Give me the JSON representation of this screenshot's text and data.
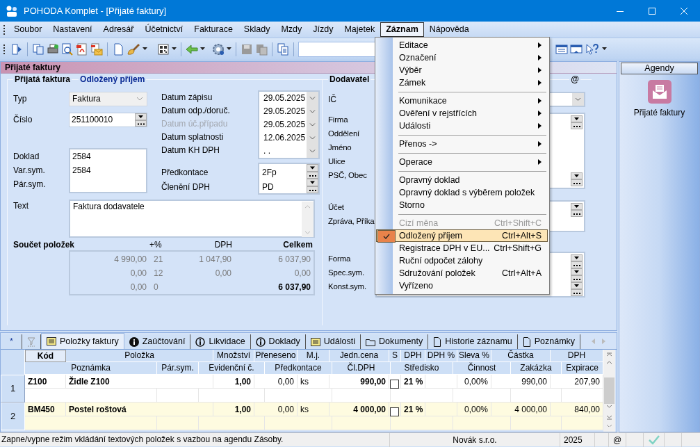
{
  "window": {
    "title": "POHODA Komplet - [Přijaté faktury]"
  },
  "menu_bar": [
    {
      "label": "Soubor",
      "selected": false
    },
    {
      "label": "Nastavení",
      "selected": false
    },
    {
      "label": "Adresář",
      "selected": false
    },
    {
      "label": "Účetnictví",
      "selected": false
    },
    {
      "label": "Fakturace",
      "selected": false
    },
    {
      "label": "Sklady",
      "selected": false
    },
    {
      "label": "Mzdy",
      "selected": false
    },
    {
      "label": "Jízdy",
      "selected": false
    },
    {
      "label": "Majetek",
      "selected": false
    },
    {
      "label": "Záznam",
      "selected": true
    },
    {
      "label": "Nápověda",
      "selected": false
    }
  ],
  "panel_title": "Přijaté faktury",
  "invoice": {
    "heading": "Přijatá faktura",
    "mode": "Odložený příjem",
    "type": {
      "label": "Typ",
      "value": "Faktura"
    },
    "number": {
      "label": "Číslo",
      "value": "251100010"
    },
    "references": [
      {
        "label": "Doklad",
        "value": "2584"
      },
      {
        "label": "Var.sym.",
        "value": "2584"
      },
      {
        "label": "Pár.sym."
      }
    ],
    "dates": [
      {
        "label": "Datum zápisu",
        "value": "29.05.2025",
        "disabled": false
      },
      {
        "label": "Datum odp./doruč.",
        "value": "29.05.2025",
        "disabled": false
      },
      {
        "label": "Datum úč.případu",
        "value": "29.05.2025",
        "disabled": true
      },
      {
        "label": "Datum splatnosti",
        "value": "12.06.2025",
        "disabled": false
      },
      {
        "label": "Datum KH DPH",
        "value": ". .",
        "disabled": false
      }
    ],
    "posting": [
      {
        "label": "Předkontace",
        "value": "2Fp"
      },
      {
        "label": "Členění DPH",
        "value": "PD"
      }
    ],
    "text": {
      "label": "Text",
      "value": "Faktura dodavatele"
    },
    "summary": {
      "title": "Součet položek",
      "columns": [
        "+%",
        "DPH",
        "Celkem"
      ],
      "rows": [
        {
          "kind": "rate",
          "base": "4 990,00",
          "rate": "21",
          "vat": "1 047,90",
          "total": "6 037,90"
        },
        {
          "kind": "rate",
          "base": "0,00",
          "rate": "12",
          "vat": "0,00",
          "total": "0,00"
        },
        {
          "kind": "total",
          "base": "0,00",
          "rate": "0",
          "total": "6 037,90"
        }
      ]
    }
  },
  "supplier": {
    "heading": "Dodavatel",
    "contact_heading": "@",
    "id_label": "IČ",
    "address_labels": [
      "Firma",
      "Oddělení",
      "Jméno",
      "Ulice",
      "PSČ, Obec"
    ],
    "bank_labels": [
      "Účet",
      "Zpráva, Příka"
    ],
    "payment_labels": [
      "Forma",
      "Spec.sym.",
      "Konst.sym."
    ]
  },
  "context_menu": {
    "items": [
      {
        "kind": "item",
        "label": "Editace",
        "submenu": true,
        "disabled": false,
        "checked": false,
        "selected": false
      },
      {
        "kind": "item",
        "label": "Označení",
        "submenu": true,
        "disabled": false,
        "checked": false,
        "selected": false
      },
      {
        "kind": "item",
        "label": "Výběr",
        "submenu": true,
        "disabled": false,
        "checked": false,
        "selected": false
      },
      {
        "kind": "item",
        "label": "Zámek",
        "submenu": true,
        "disabled": false,
        "checked": false,
        "selected": false
      },
      {
        "kind": "separator"
      },
      {
        "kind": "item",
        "label": "Komunikace",
        "submenu": true,
        "disabled": false,
        "checked": false,
        "selected": false
      },
      {
        "kind": "item",
        "label": "Ověření v rejstřících",
        "submenu": true,
        "disabled": false,
        "checked": false,
        "selected": false
      },
      {
        "kind": "item",
        "label": "Události",
        "submenu": true,
        "disabled": false,
        "checked": false,
        "selected": false
      },
      {
        "kind": "separator"
      },
      {
        "kind": "item",
        "label": "Přenos ->",
        "submenu": true,
        "disabled": false,
        "checked": false,
        "selected": false
      },
      {
        "kind": "separator"
      },
      {
        "kind": "item",
        "label": "Operace",
        "submenu": true,
        "disabled": false,
        "checked": false,
        "selected": false
      },
      {
        "kind": "separator"
      },
      {
        "kind": "item",
        "label": "Opravný doklad",
        "submenu": false,
        "disabled": false,
        "checked": false,
        "selected": false
      },
      {
        "kind": "item",
        "label": "Opravný doklad s výběrem položek",
        "submenu": false,
        "disabled": false,
        "checked": false,
        "selected": false
      },
      {
        "kind": "item",
        "label": "Storno",
        "submenu": false,
        "disabled": false,
        "checked": false,
        "selected": false
      },
      {
        "kind": "separator"
      },
      {
        "kind": "item",
        "label": "Cizí měna",
        "shortcut": "Ctrl+Shift+C",
        "submenu": false,
        "disabled": true,
        "checked": false,
        "selected": false
      },
      {
        "kind": "item",
        "label": "Odložený příjem",
        "shortcut": "Ctrl+Alt+S",
        "submenu": false,
        "disabled": false,
        "checked": true,
        "selected": true
      },
      {
        "kind": "item",
        "label": "Registrace DPH v EU...",
        "shortcut": "Ctrl+Shift+G",
        "submenu": false,
        "disabled": false,
        "checked": false,
        "selected": false
      },
      {
        "kind": "item",
        "label": "Ruční odpočet zálohy",
        "submenu": false,
        "disabled": false,
        "checked": false,
        "selected": false
      },
      {
        "kind": "item",
        "label": "Sdružování položek",
        "shortcut": "Ctrl+Alt+A",
        "submenu": false,
        "disabled": false,
        "checked": false,
        "selected": false
      },
      {
        "kind": "item",
        "label": "Vyřízeno",
        "submenu": false,
        "disabled": false,
        "checked": false,
        "selected": false
      }
    ]
  },
  "tabs": [
    {
      "kind": "plain",
      "label": "*",
      "selected": false
    },
    {
      "kind": "filter",
      "selected": false
    },
    {
      "kind": "list",
      "label": "Položky faktury",
      "selected": true
    },
    {
      "kind": "info",
      "label": "Zaúčtování",
      "selected": false
    },
    {
      "kind": "info-outline",
      "label": "Likvidace",
      "selected": false
    },
    {
      "kind": "info-outline",
      "label": "Doklady",
      "selected": false
    },
    {
      "kind": "list",
      "label": "Události",
      "selected": false
    },
    {
      "kind": "folder",
      "label": "Dokumenty",
      "selected": false
    },
    {
      "kind": "page",
      "label": "Historie záznamu",
      "selected": false
    },
    {
      "kind": "page",
      "label": "Poznámky",
      "selected": false
    }
  ],
  "grid": {
    "columns_top": [
      "Kód",
      "Položka",
      "Množství",
      "Přeneseno",
      "M.j.",
      "Jedn.cena",
      "S",
      "DPH",
      "DPH %",
      "Sleva %",
      "Částka",
      "DPH"
    ],
    "columns_bottom": [
      "Poznámka",
      "Pár.sym.",
      "Evidenční č.",
      "Předkontace",
      "Čl.DPH",
      "Středisko",
      "Činnost",
      "Zakázka",
      "Expirace"
    ],
    "rows": [
      {
        "number": "1",
        "selected": false,
        "code": "Z100",
        "item": "Židle Z100",
        "quantity": "1,00",
        "transferred": "0,00",
        "unit": "ks",
        "unit_price": "990,00",
        "s_checked": false,
        "vat_rate": "21 %",
        "discount": "0,00%",
        "amount": "990,00",
        "vat": "207,90"
      },
      {
        "number": "2",
        "selected": true,
        "code": "BM450",
        "item": "Postel roštová",
        "quantity": "1,00",
        "transferred": "0,00",
        "unit": "ks",
        "unit_price": "4 000,00",
        "s_checked": false,
        "vat_rate": "21 %",
        "discount": "0,00%",
        "amount": "4 000,00",
        "vat": "840,00"
      }
    ]
  },
  "agendas": {
    "title": "Agendy",
    "items": [
      {
        "label": "Přijaté faktury"
      }
    ]
  },
  "status_bar": {
    "message": "Zapne/vypne režim vkládání textových položek s vazbou na agendu Zásoby.",
    "company": "Novák s.r.o.",
    "year": "2025",
    "email": "@"
  }
}
